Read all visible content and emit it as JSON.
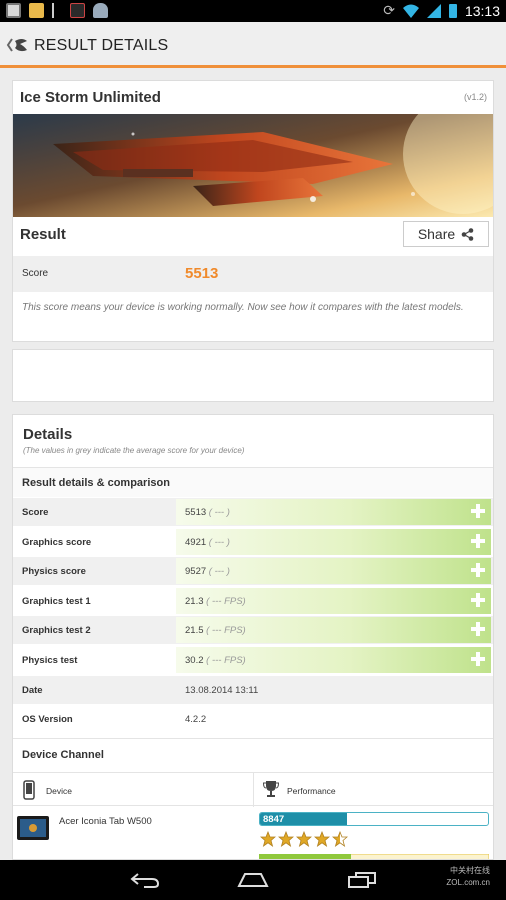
{
  "status_bar": {
    "time": "13:13"
  },
  "action_bar": {
    "title": "RESULT DETAILS"
  },
  "result_card": {
    "title": "Ice Storm Unlimited",
    "version": "(v1.2)",
    "result_heading": "Result",
    "share_label": "Share",
    "score_label": "Score",
    "score_value": "5513",
    "note": "This score means your device is working normally. Now see how it compares with the latest models."
  },
  "details": {
    "title": "Details",
    "subtitle": "(The values in grey indicate the average score for your device)",
    "section_heading": "Result details & comparison",
    "rows": [
      {
        "label": "Score",
        "value": "5513",
        "avg": "( --- )",
        "expandable": true
      },
      {
        "label": "Graphics score",
        "value": "4921",
        "avg": "( --- )",
        "expandable": true
      },
      {
        "label": "Physics score",
        "value": "9527",
        "avg": "( --- )",
        "expandable": true
      },
      {
        "label": "Graphics test 1",
        "value": "21.3",
        "avg": "( --- FPS)",
        "expandable": true
      },
      {
        "label": "Graphics test 2",
        "value": "21.5",
        "avg": "( --- FPS)",
        "expandable": true
      },
      {
        "label": "Physics test",
        "value": "30.2",
        "avg": "( --- FPS)",
        "expandable": true
      },
      {
        "label": "Date",
        "value": "13.08.2014 13:11",
        "avg": "",
        "expandable": false
      },
      {
        "label": "OS Version",
        "value": "4.2.2",
        "avg": "",
        "expandable": false
      }
    ],
    "device_channel_heading": "Device Channel",
    "device_col_label": "Device",
    "performance_col_label": "Performance",
    "devices": [
      {
        "name": "Acer Iconia Tab W500",
        "score": "8847",
        "bar_fraction": 0.38,
        "rating_stars": 4.5
      }
    ]
  },
  "colors": {
    "accent": "#f0903a",
    "score": "#f08a2b",
    "bar": "#1e8fa8",
    "plus_green": "#bfe28b"
  },
  "watermark": {
    "line1": "中关村在线",
    "line2": "ZOL.com.cn"
  }
}
